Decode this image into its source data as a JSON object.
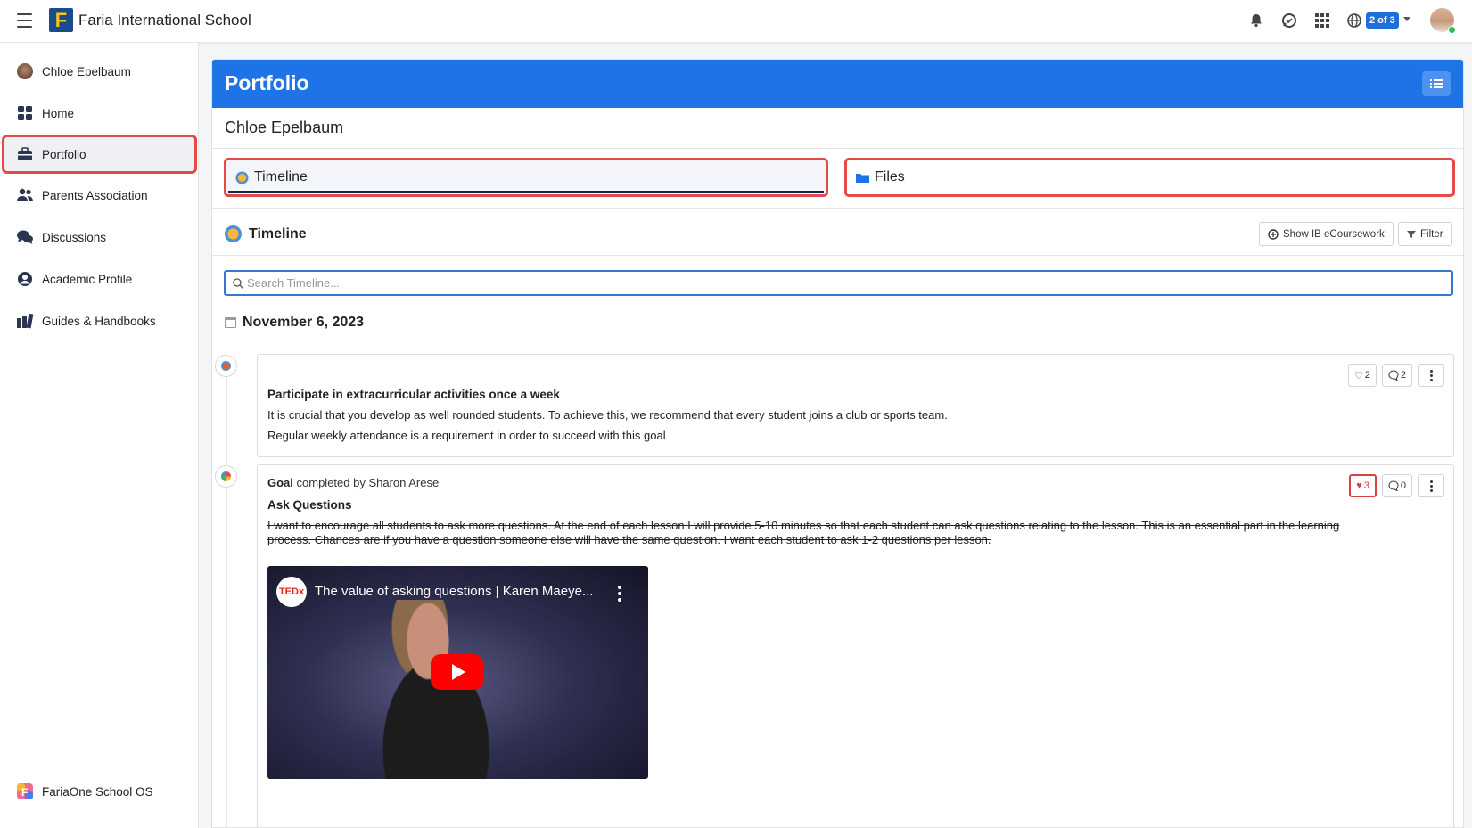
{
  "header": {
    "school_name": "Faria International School",
    "logo_letter": "F",
    "switcher_badge": "2 of 3",
    "icons": [
      "hamburger-icon",
      "bell-icon",
      "chat-icon",
      "apps-grid-icon",
      "globe-icon"
    ]
  },
  "sidebar": {
    "items": [
      {
        "label": "Chloe Epelbaum",
        "icon": "avatar"
      },
      {
        "label": "Home",
        "icon": "dashboard-icon"
      },
      {
        "label": "Portfolio",
        "icon": "briefcase-icon",
        "active": true
      },
      {
        "label": "Parents Association",
        "icon": "people-icon"
      },
      {
        "label": "Discussions",
        "icon": "chat-bubbles-icon"
      },
      {
        "label": "Academic Profile",
        "icon": "user-circle-icon"
      },
      {
        "label": "Guides & Handbooks",
        "icon": "books-icon"
      }
    ],
    "footer_label": "FariaOne School OS"
  },
  "page": {
    "title": "Portfolio",
    "student_name": "Chloe Epelbaum",
    "tabs": [
      {
        "label": "Timeline",
        "active": true
      },
      {
        "label": "Files",
        "active": false
      }
    ],
    "section_title": "Timeline",
    "show_ib_label": "Show IB eCoursework",
    "filter_label": "Filter",
    "search_placeholder": "Search Timeline..."
  },
  "timeline": {
    "date": "November 6, 2023",
    "entries": [
      {
        "title": "Participate in extracurricular activities once a week",
        "lines": [
          "It is crucial that you develop as well rounded students. To achieve this, we recommend that every student joins a club or sports team.",
          "Regular weekly attendance is a requirement in order to succeed with this goal"
        ],
        "likes": "2",
        "comments": "2"
      },
      {
        "meta_type": "Goal",
        "meta_rest": " completed by Sharon Arese",
        "title": "Ask Questions",
        "body": "I want to encourage all students to ask more questions. At the end of each lesson I will provide 5-10 minutes so that each student can ask questions relating to the lesson. This is an essential part in the learning process. Chances are if you have a question someone else will have the same question. I want each student to ask 1-2 questions per lesson.",
        "likes": "3",
        "comments": "0",
        "video": {
          "title": "The value of asking questions | Karen Maeye...",
          "channel_badge": "TEDx"
        }
      }
    ]
  },
  "colors": {
    "primary": "#1e74e6",
    "highlight": "#e34b4b",
    "like_red": "#d94040"
  }
}
